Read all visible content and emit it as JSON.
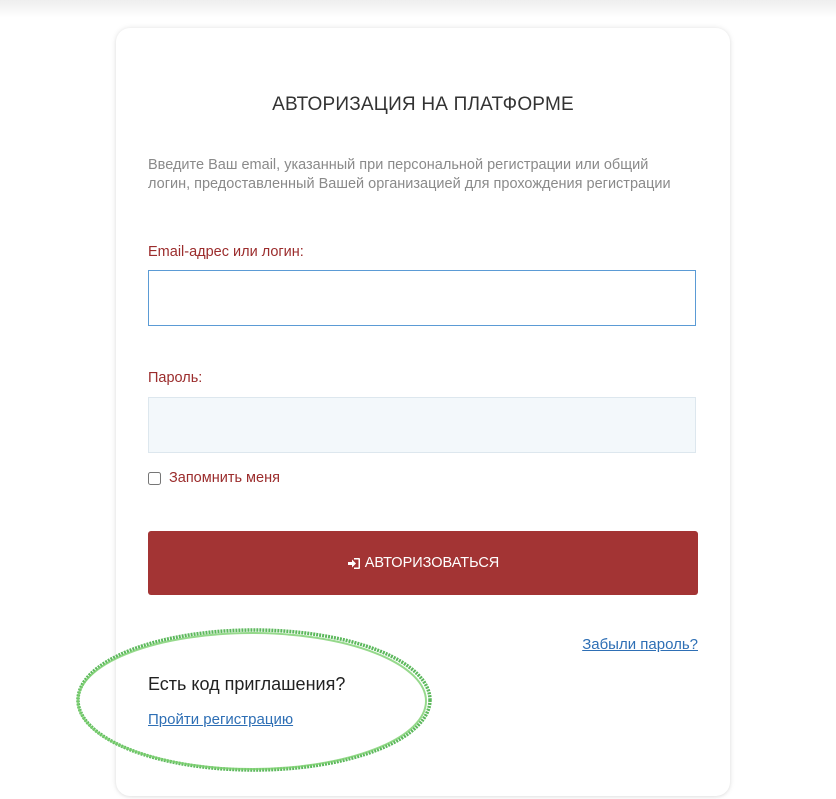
{
  "login": {
    "title": "АВТОРИЗАЦИЯ НА ПЛАТФОРМЕ",
    "intro": "Введите Ваш email, указанный при персональной регистрации или общий логин, предоставленный Вашей организацией для прохождения регистрации",
    "email_label": "Email-адрес или логин:",
    "email_value": "",
    "password_label": "Пароль:",
    "password_value": "",
    "remember_label": "Запомнить меня",
    "remember_checked": false,
    "submit_label": "АВТОРИЗОВАТЬСЯ",
    "submit_icon": "sign-in-icon",
    "forgot_link": "Забыли пароль?",
    "invite_question": "Есть код приглашения?",
    "register_link": "Пройти регистрацию"
  },
  "colors": {
    "accent_button": "#a33434",
    "label_text": "#9b2c2c",
    "link": "#2e6fb5",
    "highlight_ellipse": "#5cb85c"
  }
}
